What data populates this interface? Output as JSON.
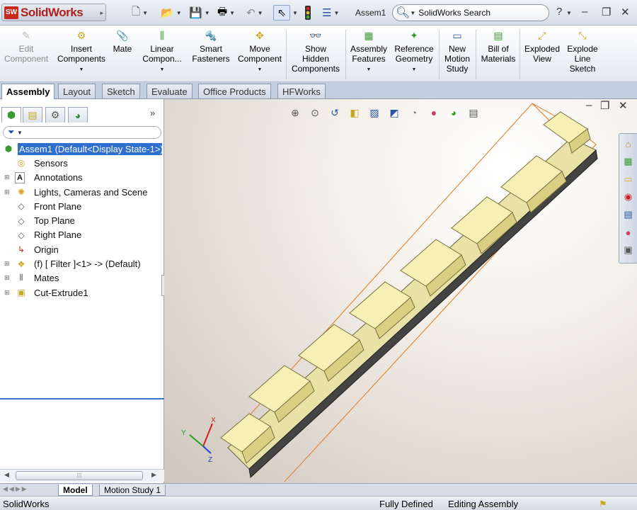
{
  "titlebar": {
    "app_name": "SolidWorks",
    "doc_title": "Assem1",
    "search_placeholder": "SolidWorks Search",
    "help_glyph": "?",
    "minimize_glyph": "–",
    "restore_glyph": "❐",
    "close_glyph": "✕"
  },
  "commands": [
    {
      "label": "Edit\nComponent",
      "icon": "edit-component-icon",
      "disabled": true
    },
    {
      "label": "Insert\nComponents",
      "icon": "insert-components-icon"
    },
    {
      "label": "Mate",
      "icon": "mate-icon"
    },
    {
      "label": "Linear\nCompon...",
      "icon": "linear-pattern-icon"
    },
    {
      "label": "Smart\nFasteners",
      "icon": "smart-fasteners-icon"
    },
    {
      "label": "Move\nComponent",
      "icon": "move-component-icon"
    },
    {
      "label": "Show\nHidden\nComponents",
      "icon": "show-hidden-icon"
    },
    {
      "label": "Assembly\nFeatures",
      "icon": "assembly-features-icon"
    },
    {
      "label": "Reference\nGeometry",
      "icon": "reference-geometry-icon"
    },
    {
      "label": "New\nMotion\nStudy",
      "icon": "motion-study-icon"
    },
    {
      "label": "Bill of\nMaterials",
      "icon": "bom-icon"
    },
    {
      "label": "Exploded\nView",
      "icon": "exploded-view-icon"
    },
    {
      "label": "Explode\nLine\nSketch",
      "icon": "explode-line-icon"
    }
  ],
  "tabs": [
    "Assembly",
    "Layout",
    "Sketch",
    "Evaluate",
    "Office Products",
    "HFWorks"
  ],
  "tree": {
    "filter_glyph": "▼",
    "nodes": [
      "Assem1 (Default<Display State-1>)",
      "Sensors",
      "Annotations",
      "Lights, Cameras and Scene",
      "Front Plane",
      "Top Plane",
      "Right Plane",
      "Origin",
      "(f) [ Filter ]<1> -> (Default)",
      "Mates",
      "Cut-Extrude1"
    ]
  },
  "triad": {
    "x": "X",
    "y": "Y",
    "z": "Z"
  },
  "bottom_tabs": [
    "Model",
    "Motion Study 1"
  ],
  "status": {
    "app": "SolidWorks",
    "definition": "Fully Defined",
    "mode": "Editing Assembly"
  },
  "colors": {
    "part_face": "#f6f0b4",
    "part_shadow": "#d8cf82",
    "bbox": "#e07a1e",
    "selection": "#2f6fd0"
  }
}
